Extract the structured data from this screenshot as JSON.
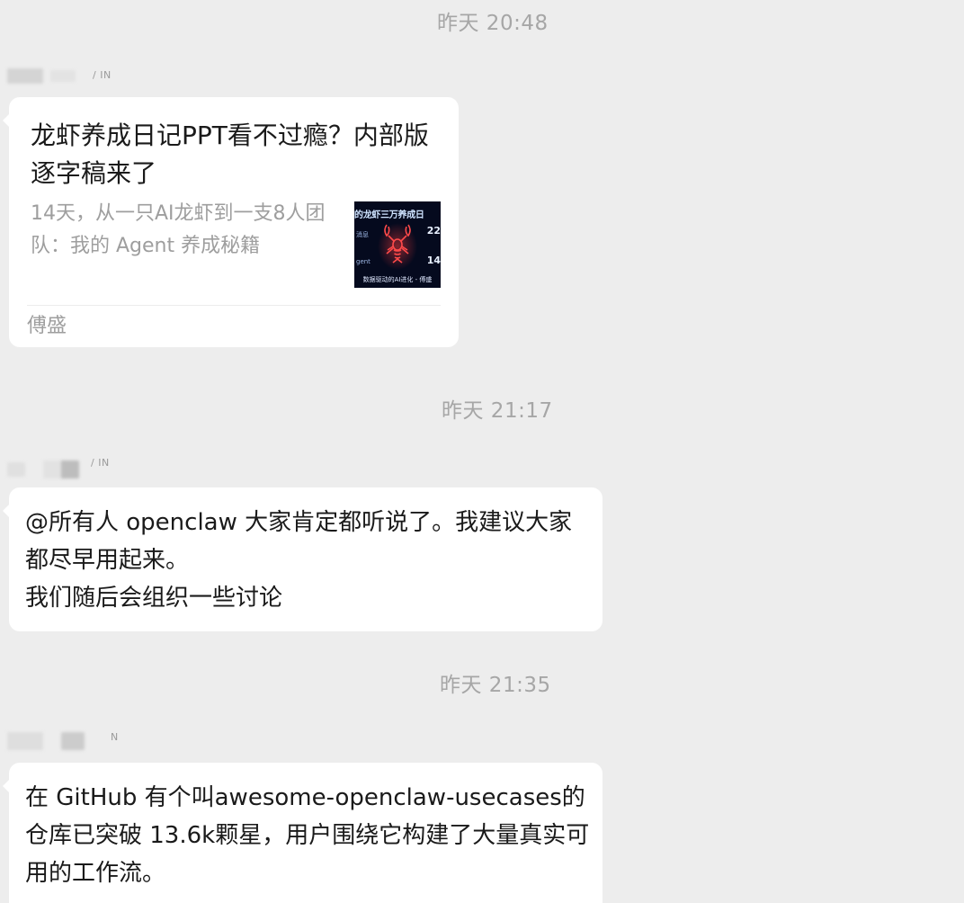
{
  "timestamps": [
    "昨天 20:48",
    "昨天 21:17",
    "昨天 21:35"
  ],
  "messages": [
    {
      "sender_tag": "/ IN",
      "card": {
        "title": "龙虾养成日记PPT看不过瘾？内部版逐字稿来了",
        "description": "14天，从一只AI龙虾到一支8人团队：我的 Agent 养成秘籍",
        "source": "傅盛",
        "thumbnail": {
          "title": "的龙虾三万养成日",
          "side_top": "消息",
          "side_bottom": "gent",
          "num_top": "22",
          "num_bottom": "14",
          "footer": "数据驱动的AI进化 - 傅盛"
        }
      }
    },
    {
      "sender_tag": "/ IN",
      "text": "@所有人 openclaw 大家肯定都听说了。我建议大家都尽早用起来。\n我们随后会组织一些讨论"
    },
    {
      "sender_tag": "N",
      "text": "在 GitHub 有个叫awesome-openclaw-usecases的仓库已突破 13.6k颗星，用户围绕它构建了大量真实可用的工作流。"
    }
  ],
  "colors": {
    "background": "#ededed",
    "bubble": "#ffffff",
    "timestamp": "#a6a6a6",
    "text": "#1a1a1a",
    "secondary_text": "#9e9e9e",
    "lobster_accent": "#ff3b3b"
  }
}
